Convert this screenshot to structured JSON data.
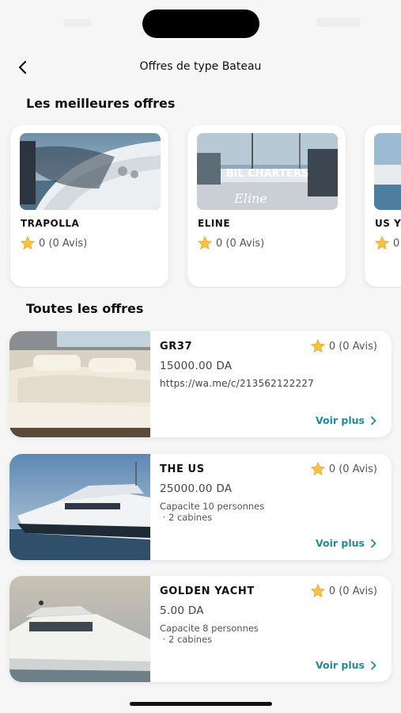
{
  "header": {
    "title": "Offres de type Bateau"
  },
  "sections": {
    "featured_title": "Les meilleures offres",
    "all_title": "Toutes les offres"
  },
  "featured": [
    {
      "name": "TRAPOLLA",
      "rating": "0 (0 Avis)"
    },
    {
      "name": "ELINE",
      "rating": "0 (0 Avis)",
      "image_text_1": "BIL CHARTERS",
      "image_text_2": "Eline"
    },
    {
      "name": "US Y",
      "rating": "0"
    }
  ],
  "offers": [
    {
      "name": "GR37",
      "rating": "0 (0 Avis)",
      "price": "15000.00 DA",
      "desc": "https://wa.me/c/213562122227",
      "action": "Voir plus"
    },
    {
      "name": "THE US",
      "rating": "0 (0 Avis)",
      "price": "25000.00 DA",
      "desc_line1": "Capacite 10 personnes",
      "desc_line2": " · 2 cabines",
      "action": "Voir plus"
    },
    {
      "name": "GOLDEN YACHT",
      "rating": "0 (0 Avis)",
      "price": "5.00 DA",
      "desc_line1": "Capacite 8 personnes",
      "desc_line2": " · 2 cabines",
      "action": "Voir plus"
    }
  ],
  "colors": {
    "accent": "#1f8a9c",
    "star": "#f5c242",
    "background": "#f6f6f6"
  },
  "icons": [
    "back-arrow-icon",
    "star-icon",
    "chevron-right-icon"
  ]
}
